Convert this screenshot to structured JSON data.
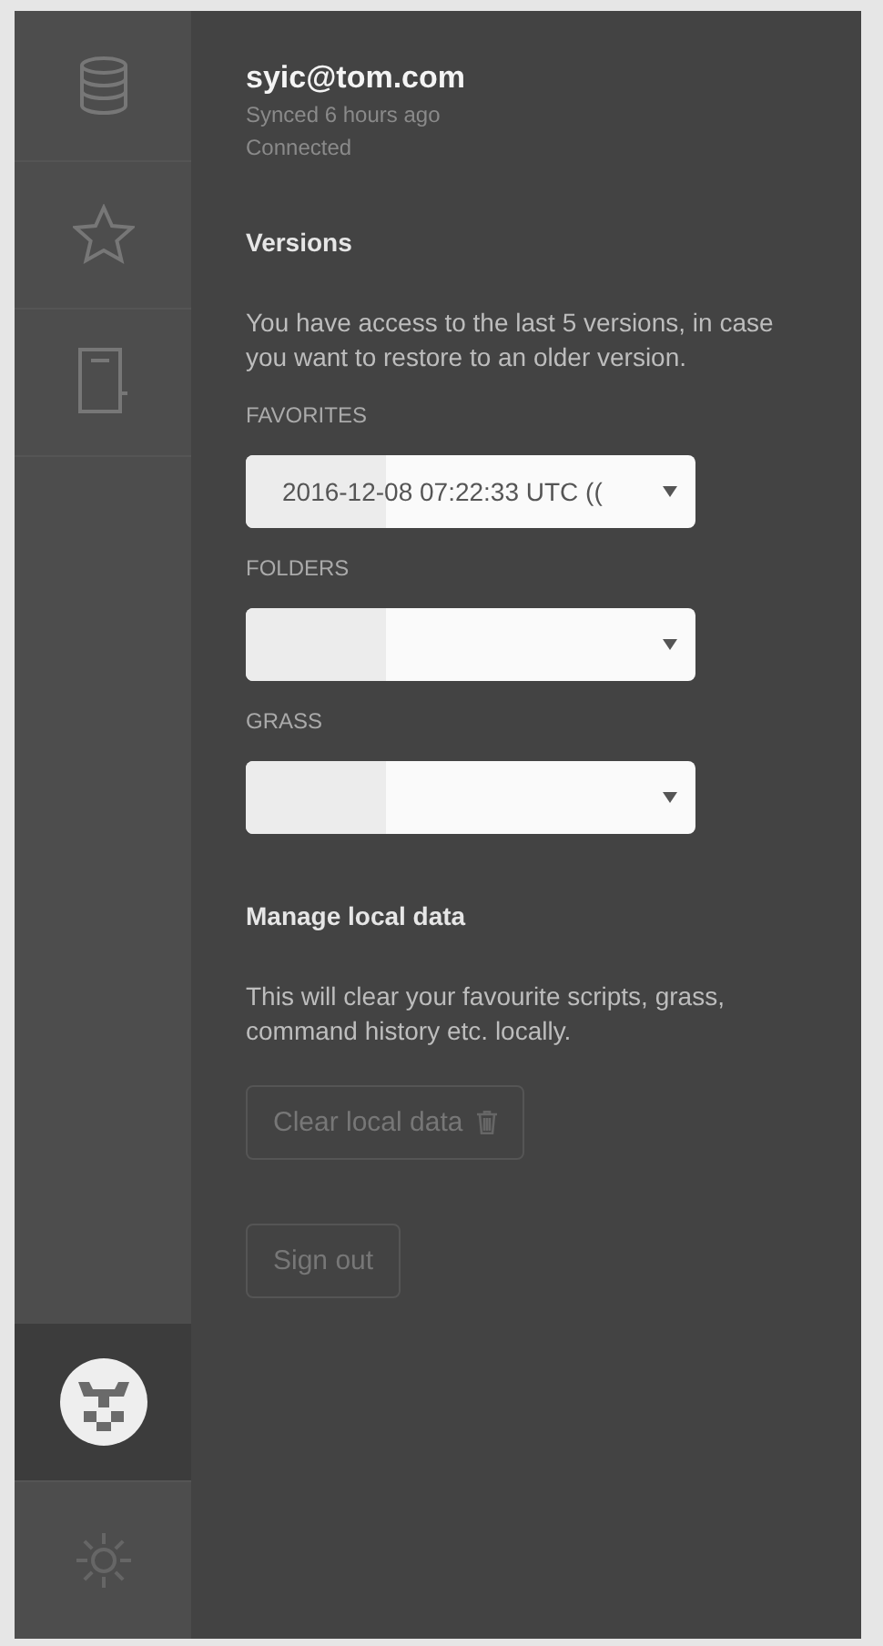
{
  "sidebar": {
    "items": [
      {
        "kind": "database",
        "selected": false
      },
      {
        "kind": "star",
        "selected": false
      },
      {
        "kind": "document",
        "selected": false
      },
      {
        "kind": "avatar",
        "selected": true
      },
      {
        "kind": "gear",
        "selected": false
      }
    ]
  },
  "account": {
    "email": "syic@tom.com",
    "sync_status": "Synced 6 hours ago",
    "connection": "Connected"
  },
  "versions": {
    "heading": "Versions",
    "description": "You have access to the last 5 versions, in case you want to restore to an older version.",
    "selects": [
      {
        "label": "FAVORITES",
        "value": "2016-12-08 07:22:33 UTC (("
      },
      {
        "label": "FOLDERS"
      },
      {
        "label": "GRASS"
      }
    ]
  },
  "local_data": {
    "heading": "Manage local data",
    "description": "This will clear your favourite scripts, grass, command history etc. locally.",
    "clear_button": "Clear local data"
  },
  "sign_out_button": "Sign out"
}
